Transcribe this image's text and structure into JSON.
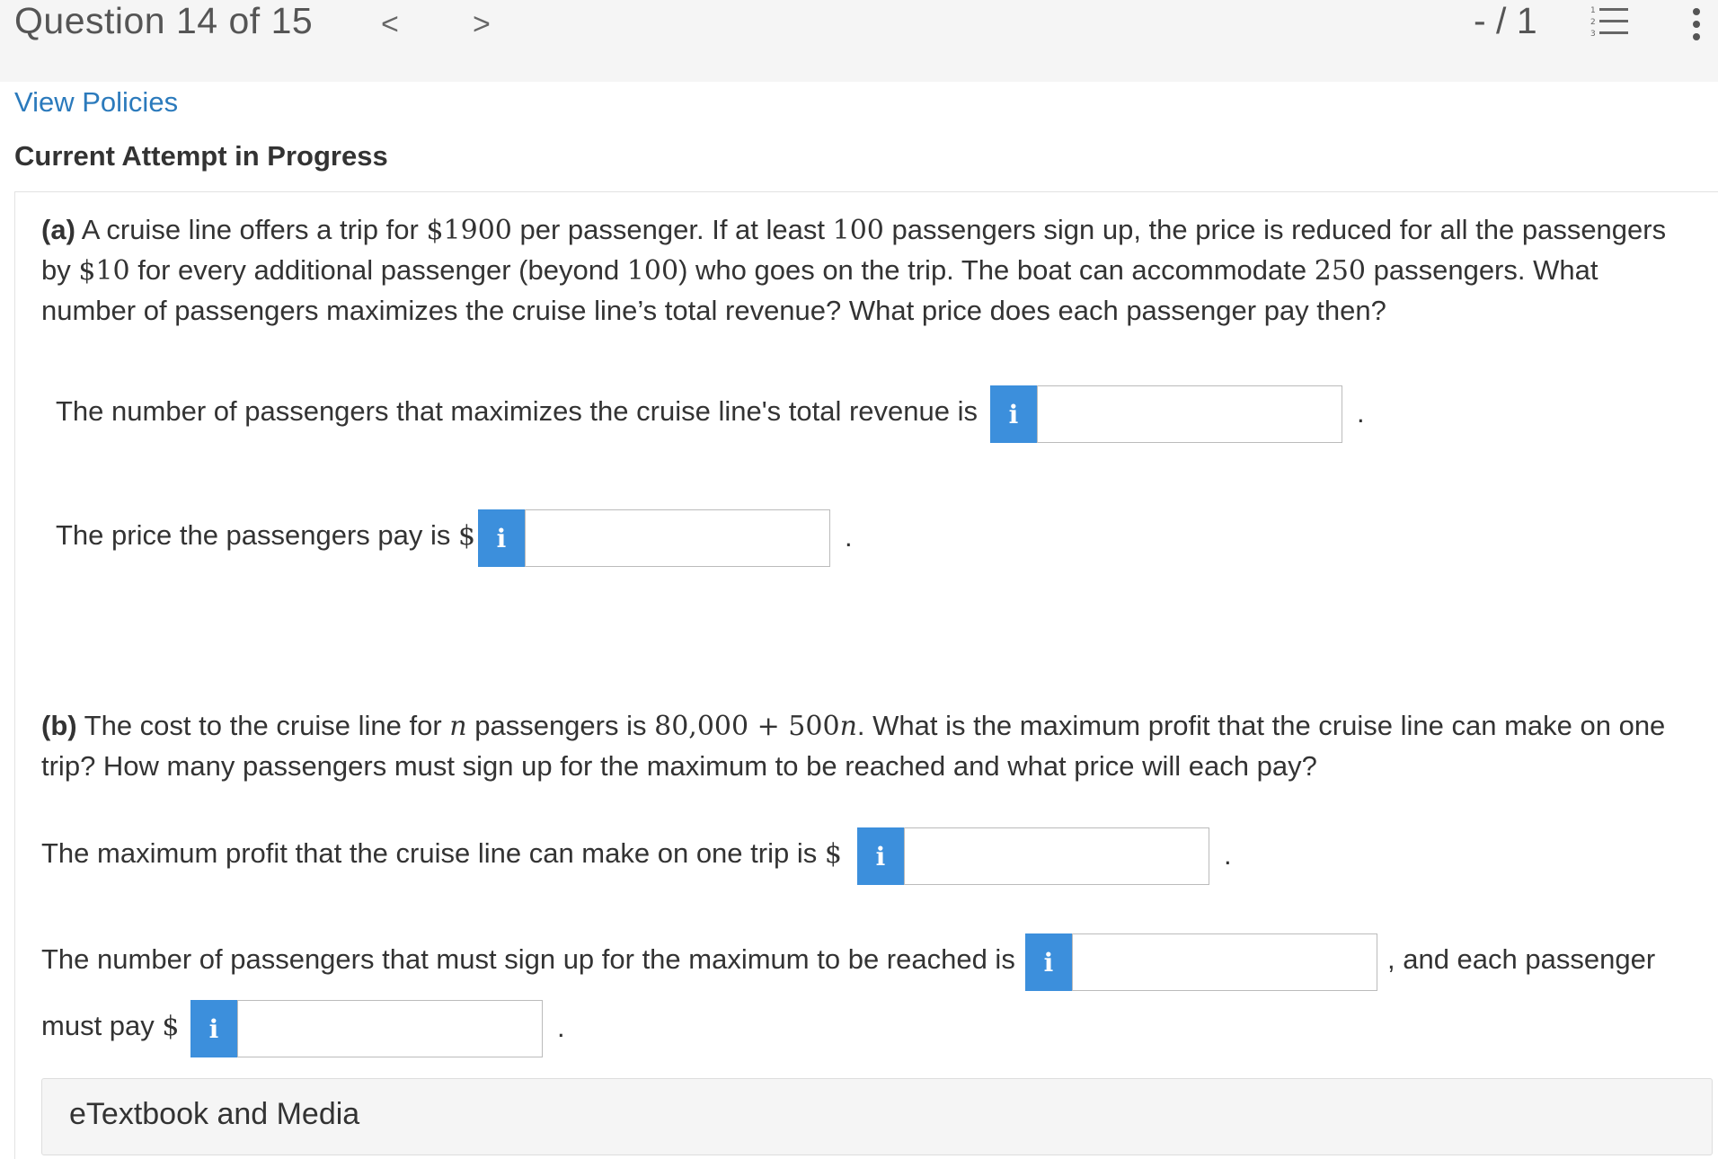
{
  "header": {
    "question_title": "Question 14 of 15",
    "prev_arrow": "<",
    "next_arrow": ">",
    "score": "- / 1"
  },
  "links": {
    "view_policies": "View Policies"
  },
  "status": {
    "attempt": "Current Attempt in Progress"
  },
  "part_a": {
    "label": "(a)",
    "text_1": " A cruise line offers a trip for ",
    "m1": "$1900",
    "text_2": " per passenger. If at least ",
    "m2": "100",
    "text_3": " passengers sign up, the price is reduced for all the passengers by ",
    "m3": "$10",
    "text_4": " for every additional passenger (beyond ",
    "m4": "100",
    "text_5": ") who goes on the trip. The boat can accommodate ",
    "m5": "250",
    "text_6": " passengers. What number of passengers maximizes the cruise line’s total revenue? What price does each passenger pay then?",
    "q1_label": "The number of passengers that maximizes the cruise line's total revenue is",
    "q1_value": "",
    "q2_label": "The price the passengers pay is ",
    "q2_dollar": "$",
    "q2_value": ""
  },
  "part_b": {
    "label": "(b)",
    "text_1": " The cost to the cruise line for ",
    "m_n": "n",
    "text_2": " passengers is ",
    "m_cost": "80,000 + 500",
    "m_cost_n": "n",
    "text_3": ". What is the maximum profit that the cruise line can make on one trip? How many passengers must sign up for the maximum to be reached and what price will each pay?",
    "q1_label": "The maximum profit that the cruise line can make on one trip is ",
    "q1_dollar": "$",
    "q1_value": "",
    "q2_label": "The number of passengers that must sign up for the maximum to be reached is",
    "q2_value": "",
    "q2_suffix": ", and each passenger",
    "q3_label": "must pay ",
    "q3_dollar": "$",
    "q3_value": ""
  },
  "info_glyph": "i",
  "period": ".",
  "etextbook": "eTextbook and Media",
  "colors": {
    "info_button": "#3c8fdc",
    "link": "#2b7abc",
    "topbar": "#f5f5f5"
  }
}
